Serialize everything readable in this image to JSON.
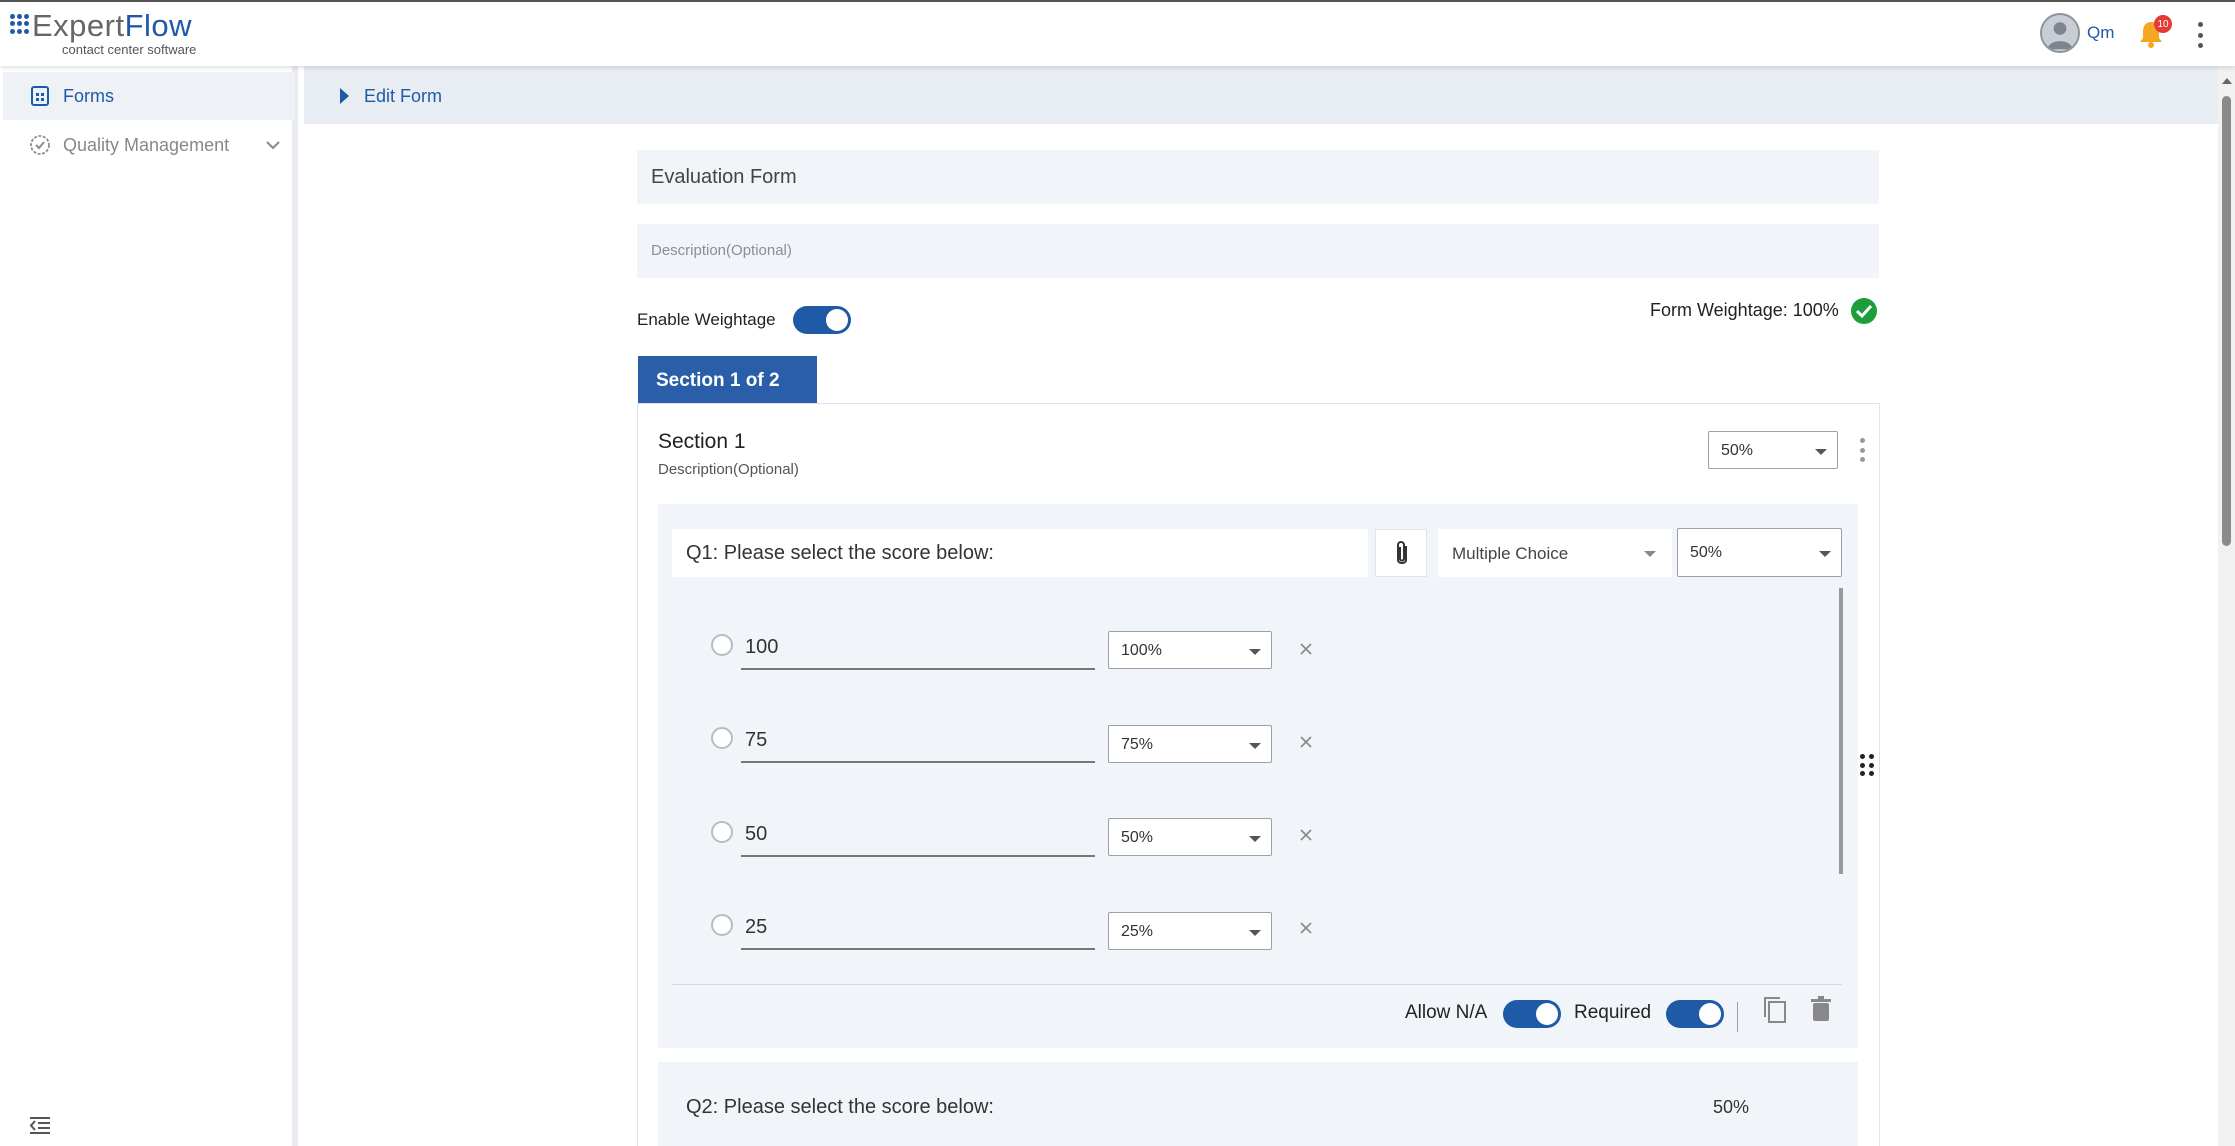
{
  "header": {
    "logo_part1": "Expert",
    "logo_part2": "Flow",
    "logo_subtitle": "contact center software",
    "user_name": "Qm",
    "notification_count": "10"
  },
  "sidebar": {
    "items": [
      {
        "label": "Forms",
        "icon": "form-icon",
        "active": true
      },
      {
        "label": "Quality Management",
        "icon": "check-circle-icon",
        "active": false
      }
    ]
  },
  "breadcrumb": {
    "title": "Edit Form"
  },
  "form": {
    "name": "Evaluation Form",
    "description_placeholder": "Description(Optional)",
    "enable_weightage_label": "Enable Weightage",
    "enable_weightage_on": true,
    "form_weightage_label": "Form Weightage: 100%"
  },
  "section": {
    "tab_label": "Section 1 of 2",
    "title": "Section 1",
    "description": "Description(Optional)",
    "weight": "50%"
  },
  "question1": {
    "text": "Q1: Please select the score below:",
    "type": "Multiple Choice",
    "weight": "50%",
    "options": [
      {
        "value": "100",
        "weight": "100%"
      },
      {
        "value": "75",
        "weight": "75%"
      },
      {
        "value": "50",
        "weight": "50%"
      },
      {
        "value": "25",
        "weight": "25%"
      }
    ],
    "allow_na_label": "Allow N/A",
    "allow_na_on": true,
    "required_label": "Required",
    "required_on": true
  },
  "question2": {
    "text": "Q2: Please select the score below:",
    "weight": "50%"
  },
  "colors": {
    "primary": "#1f5aa6",
    "success": "#1e9e3a",
    "bell": "#f5a623",
    "badge": "#e53935"
  }
}
